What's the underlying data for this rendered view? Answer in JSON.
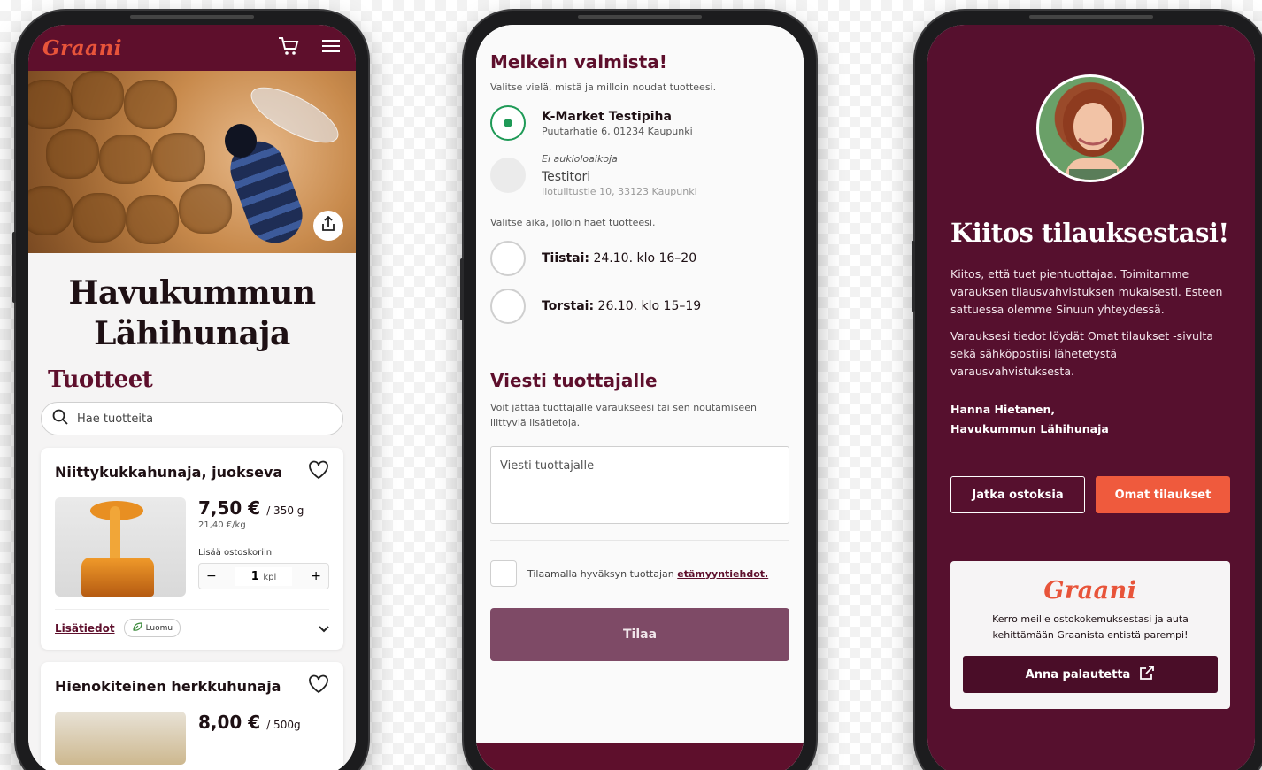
{
  "screen1": {
    "brand": "Graani",
    "shop_title": "Havukummun\nLähihunaja",
    "section_title": "Tuotteet",
    "search_placeholder": "Hae tuotteita",
    "products": [
      {
        "name": "Niittykukkahunaja, juokseva",
        "price": "7,50 €",
        "size": "/ 350 g",
        "unit_price": "21,40 €/kg",
        "add_to_cart_label": "Lisää ostoskoriin",
        "quantity": "1",
        "quantity_unit": "kpl",
        "more_info_label": "Lisätiedot",
        "badge": "Luomu"
      },
      {
        "name": "Hienokiteinen herkkuhunaja",
        "price": "8,00 €",
        "size": "/ 500g"
      }
    ]
  },
  "screen2": {
    "title": "Melkein valmista!",
    "location_hint": "Valitse vielä, mistä ja milloin noudat tuotteesi.",
    "locations": [
      {
        "name": "K-Market Testipiha",
        "address": "Puutarhatie 6, 01234 Kaupunki",
        "note": ""
      },
      {
        "name": "Testitori",
        "address": "Ilotulitustie 10, 33123 Kaupunki",
        "note": "Ei aukioloaikoja"
      }
    ],
    "time_hint": "Valitse aika, jolloin haet tuotteesi.",
    "times": [
      {
        "day": "Tiistai:",
        "time": "24.10. klo 16–20"
      },
      {
        "day": "Torstai:",
        "time": "26.10. klo 15–19"
      }
    ],
    "message_title": "Viesti tuottajalle",
    "message_hint": "Voit jättää tuottajalle varaukseesi tai sen noutamiseen liittyviä lisätietoja.",
    "message_placeholder": "Viesti tuottajalle",
    "terms_text": "Tilaamalla hyväksyn tuottajan ",
    "terms_link": "etämyyntiehdot.",
    "order_button": "Tilaa"
  },
  "screen3": {
    "title": "Kiitos tilauksestasi!",
    "paragraph1": "Kiitos, että tuet pientuottajaa. Toimitamme varauksen tilausvahvistuksen mukaisesti. Esteen sattuessa olemme Sinuun yhteydessä.",
    "paragraph2": "Varauksesi tiedot löydät Omat tilaukset -sivulta sekä sähköpostiisi lähetetystä varausvahvistuksesta.",
    "signature_name": "Hanna Hietanen,",
    "signature_org": "Havukummun Lähihunaja",
    "continue_button": "Jatka ostoksia",
    "orders_button": "Omat tilaukset",
    "feedback_brand": "Graani",
    "feedback_text": "Kerro meille ostokokemuksestasi ja auta kehittämään Graanista entistä parempi!",
    "feedback_button": "Anna palautetta"
  },
  "colors": {
    "brand_dark": "#5e0f2c",
    "brand_orange": "#ef5a3d",
    "selected_green": "#1f9a57",
    "order_button": "#7e4a66"
  },
  "icons": [
    "cart-icon",
    "menu-icon",
    "share-icon",
    "search-icon",
    "heart-icon",
    "minus-icon",
    "plus-icon",
    "leaf-icon",
    "chevron-down-icon",
    "external-link-icon"
  ]
}
